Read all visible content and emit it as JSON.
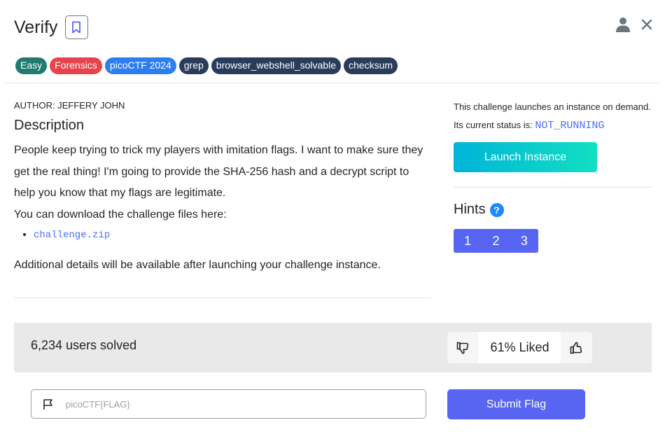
{
  "header": {
    "title": "Verify"
  },
  "tags": [
    {
      "label": "Easy",
      "color": "#1e7b6e"
    },
    {
      "label": "Forensics",
      "color": "#e8434c"
    },
    {
      "label": "picoCTF 2024",
      "color": "#2d7ef0"
    },
    {
      "label": "grep",
      "color": "#2a3b5c"
    },
    {
      "label": "browser_webshell_solvable",
      "color": "#2a3b5c"
    },
    {
      "label": "checksum",
      "color": "#2a3b5c"
    }
  ],
  "description": {
    "author": "AUTHOR: JEFFERY JOHN",
    "heading": "Description",
    "paragraph_1": "People keep trying to trick my players with imitation flags. I want to make sure they get the real thing! I'm going to provide the SHA-256 hash and a decrypt script to help you know that my flags are legitimate.",
    "paragraph_2": "You can download the challenge files here:",
    "file_link": "challenge.zip",
    "additional": "Additional details will be available after launching your challenge instance."
  },
  "instance": {
    "intro": "This challenge launches an instance on demand.",
    "status_prefix": "Its current status is:",
    "status": "NOT_RUNNING",
    "launch_label": "Launch Instance"
  },
  "hints": {
    "title": "Hints",
    "help_symbol": "?",
    "buttons": [
      "1",
      "2",
      "3"
    ]
  },
  "stats": {
    "solved": "6,234 users solved",
    "liked": "61% Liked"
  },
  "flag": {
    "placeholder": "picoCTF{FLAG}",
    "submit_label": "Submit Flag"
  },
  "colors": {
    "accent": "#5865f2",
    "link": "#4c6ef5",
    "help": "#1e88ff"
  }
}
